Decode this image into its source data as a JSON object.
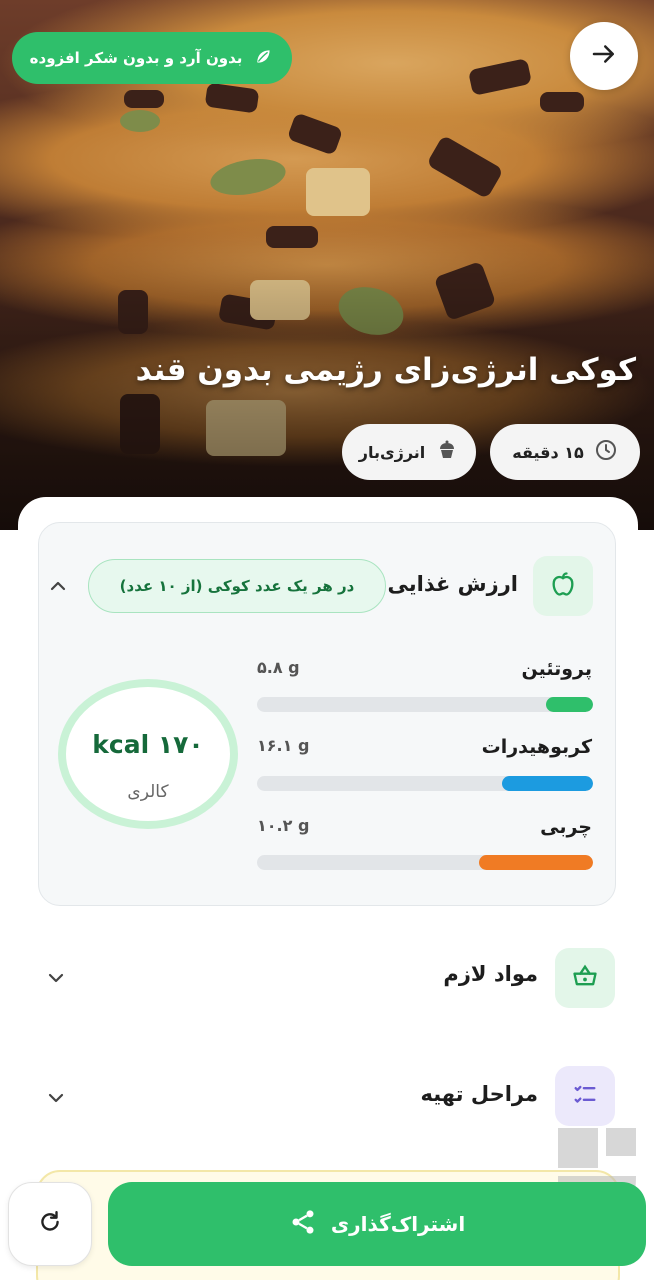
{
  "hero": {
    "badge": "بدون آرد و بدون شکر افزوده",
    "title": "کوکی انرژی‌زای رژیمی بدون قند",
    "chips": {
      "time": "۱۵ دقیقه",
      "category": "انرژی‌بار"
    }
  },
  "nutrition": {
    "title": "ارزش غذایی",
    "note": "در هر یک عدد کوکی (از ۱۰ عدد)",
    "calories": {
      "value": "۱۷۰ kcal",
      "label": "کالری"
    },
    "macros": [
      {
        "label": "پروتئین",
        "value": "۵.۸ g",
        "fill": 0.14,
        "color": "#2fbf6b"
      },
      {
        "label": "کربوهیدرات",
        "value": "۱۶.۱ g",
        "fill": 0.27,
        "color": "#1c9be0"
      },
      {
        "label": "چربی",
        "value": "۱۰.۲ g",
        "fill": 0.34,
        "color": "#f07b24"
      }
    ]
  },
  "sections": {
    "ingredients": "مواد لازم",
    "steps": "مراحل تهیه"
  },
  "actions": {
    "share": "اشتراک‌گذاری"
  },
  "colors": {
    "accent": "#2fbf6b",
    "protein": "#2fbf6b",
    "carbs": "#1c9be0",
    "fat": "#f07b24"
  }
}
